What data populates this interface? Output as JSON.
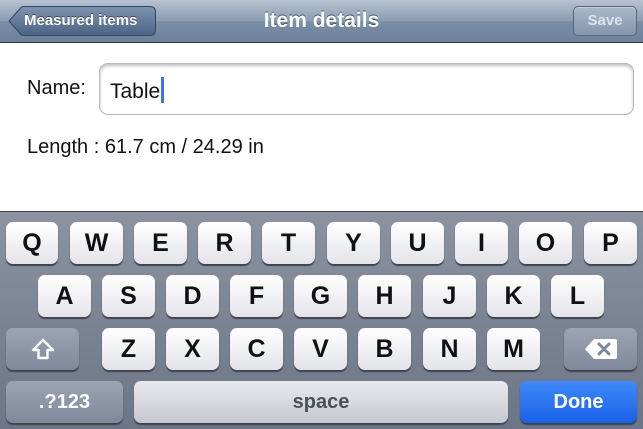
{
  "nav": {
    "back_label": "Measured items",
    "title": "Item details",
    "save_label": "Save"
  },
  "form": {
    "name_label": "Name:",
    "name_value": "Table",
    "length_label": "Length",
    "length_value": ": 61.7 cm / 24.29 in"
  },
  "keyboard": {
    "row1": [
      "Q",
      "W",
      "E",
      "R",
      "T",
      "Y",
      "U",
      "I",
      "O",
      "P"
    ],
    "row2": [
      "A",
      "S",
      "D",
      "F",
      "G",
      "H",
      "J",
      "K",
      "L"
    ],
    "row3": [
      "Z",
      "X",
      "C",
      "V",
      "B",
      "N",
      "M"
    ],
    "numbers_label": ".?123",
    "space_label": "space",
    "done_label": "Done",
    "shift_icon": "shift-arrow-icon",
    "delete_icon": "backspace-icon"
  },
  "colors": {
    "accent": "#1a60e8",
    "caret": "#3f74e8",
    "navbar": "#8a9cb2"
  }
}
